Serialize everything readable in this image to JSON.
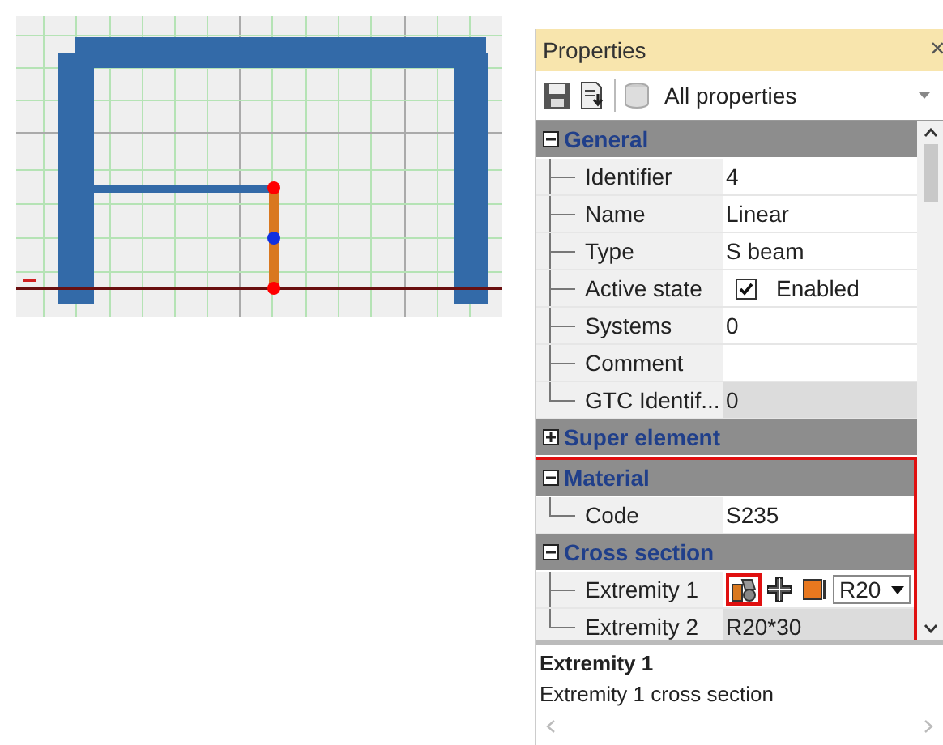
{
  "panel": {
    "title": "Properties",
    "close": "×",
    "filter": "All properties",
    "sections": [
      {
        "title": "General",
        "expanded": true,
        "highlighted": false,
        "rows": [
          {
            "label": "Identifier",
            "kind": "text",
            "value": "4",
            "readonly": false
          },
          {
            "label": "Name",
            "kind": "text",
            "value": "Linear",
            "readonly": false
          },
          {
            "label": "Type",
            "kind": "text",
            "value": "S beam",
            "readonly": false
          },
          {
            "label": "Active state",
            "kind": "checkbox",
            "checked": true,
            "value": "Enabled",
            "readonly": false
          },
          {
            "label": "Systems",
            "kind": "text",
            "value": "0",
            "readonly": false
          },
          {
            "label": "Comment",
            "kind": "text",
            "readonly": false
          },
          {
            "label": "GTC Identif...",
            "kind": "text",
            "value": "0",
            "readonly": true
          }
        ]
      },
      {
        "title": "Super element",
        "expanded": false,
        "highlighted": false
      },
      {
        "title": "Material",
        "expanded": true,
        "highlighted": true,
        "rows": [
          {
            "label": "Code",
            "kind": "text",
            "value": "S235",
            "readonly": false
          }
        ]
      },
      {
        "title": "Cross section",
        "expanded": true,
        "highlighted": true,
        "rows": [
          {
            "label": "Extremity 1",
            "kind": "section-picker",
            "value": "R20",
            "readonly": false,
            "icon_highlighted": true
          },
          {
            "label": "Extremity 2",
            "kind": "text",
            "value": "R20*30",
            "readonly": true
          }
        ]
      }
    ],
    "description": {
      "title": "Extremity 1",
      "text": "Extremity 1 cross section"
    }
  }
}
